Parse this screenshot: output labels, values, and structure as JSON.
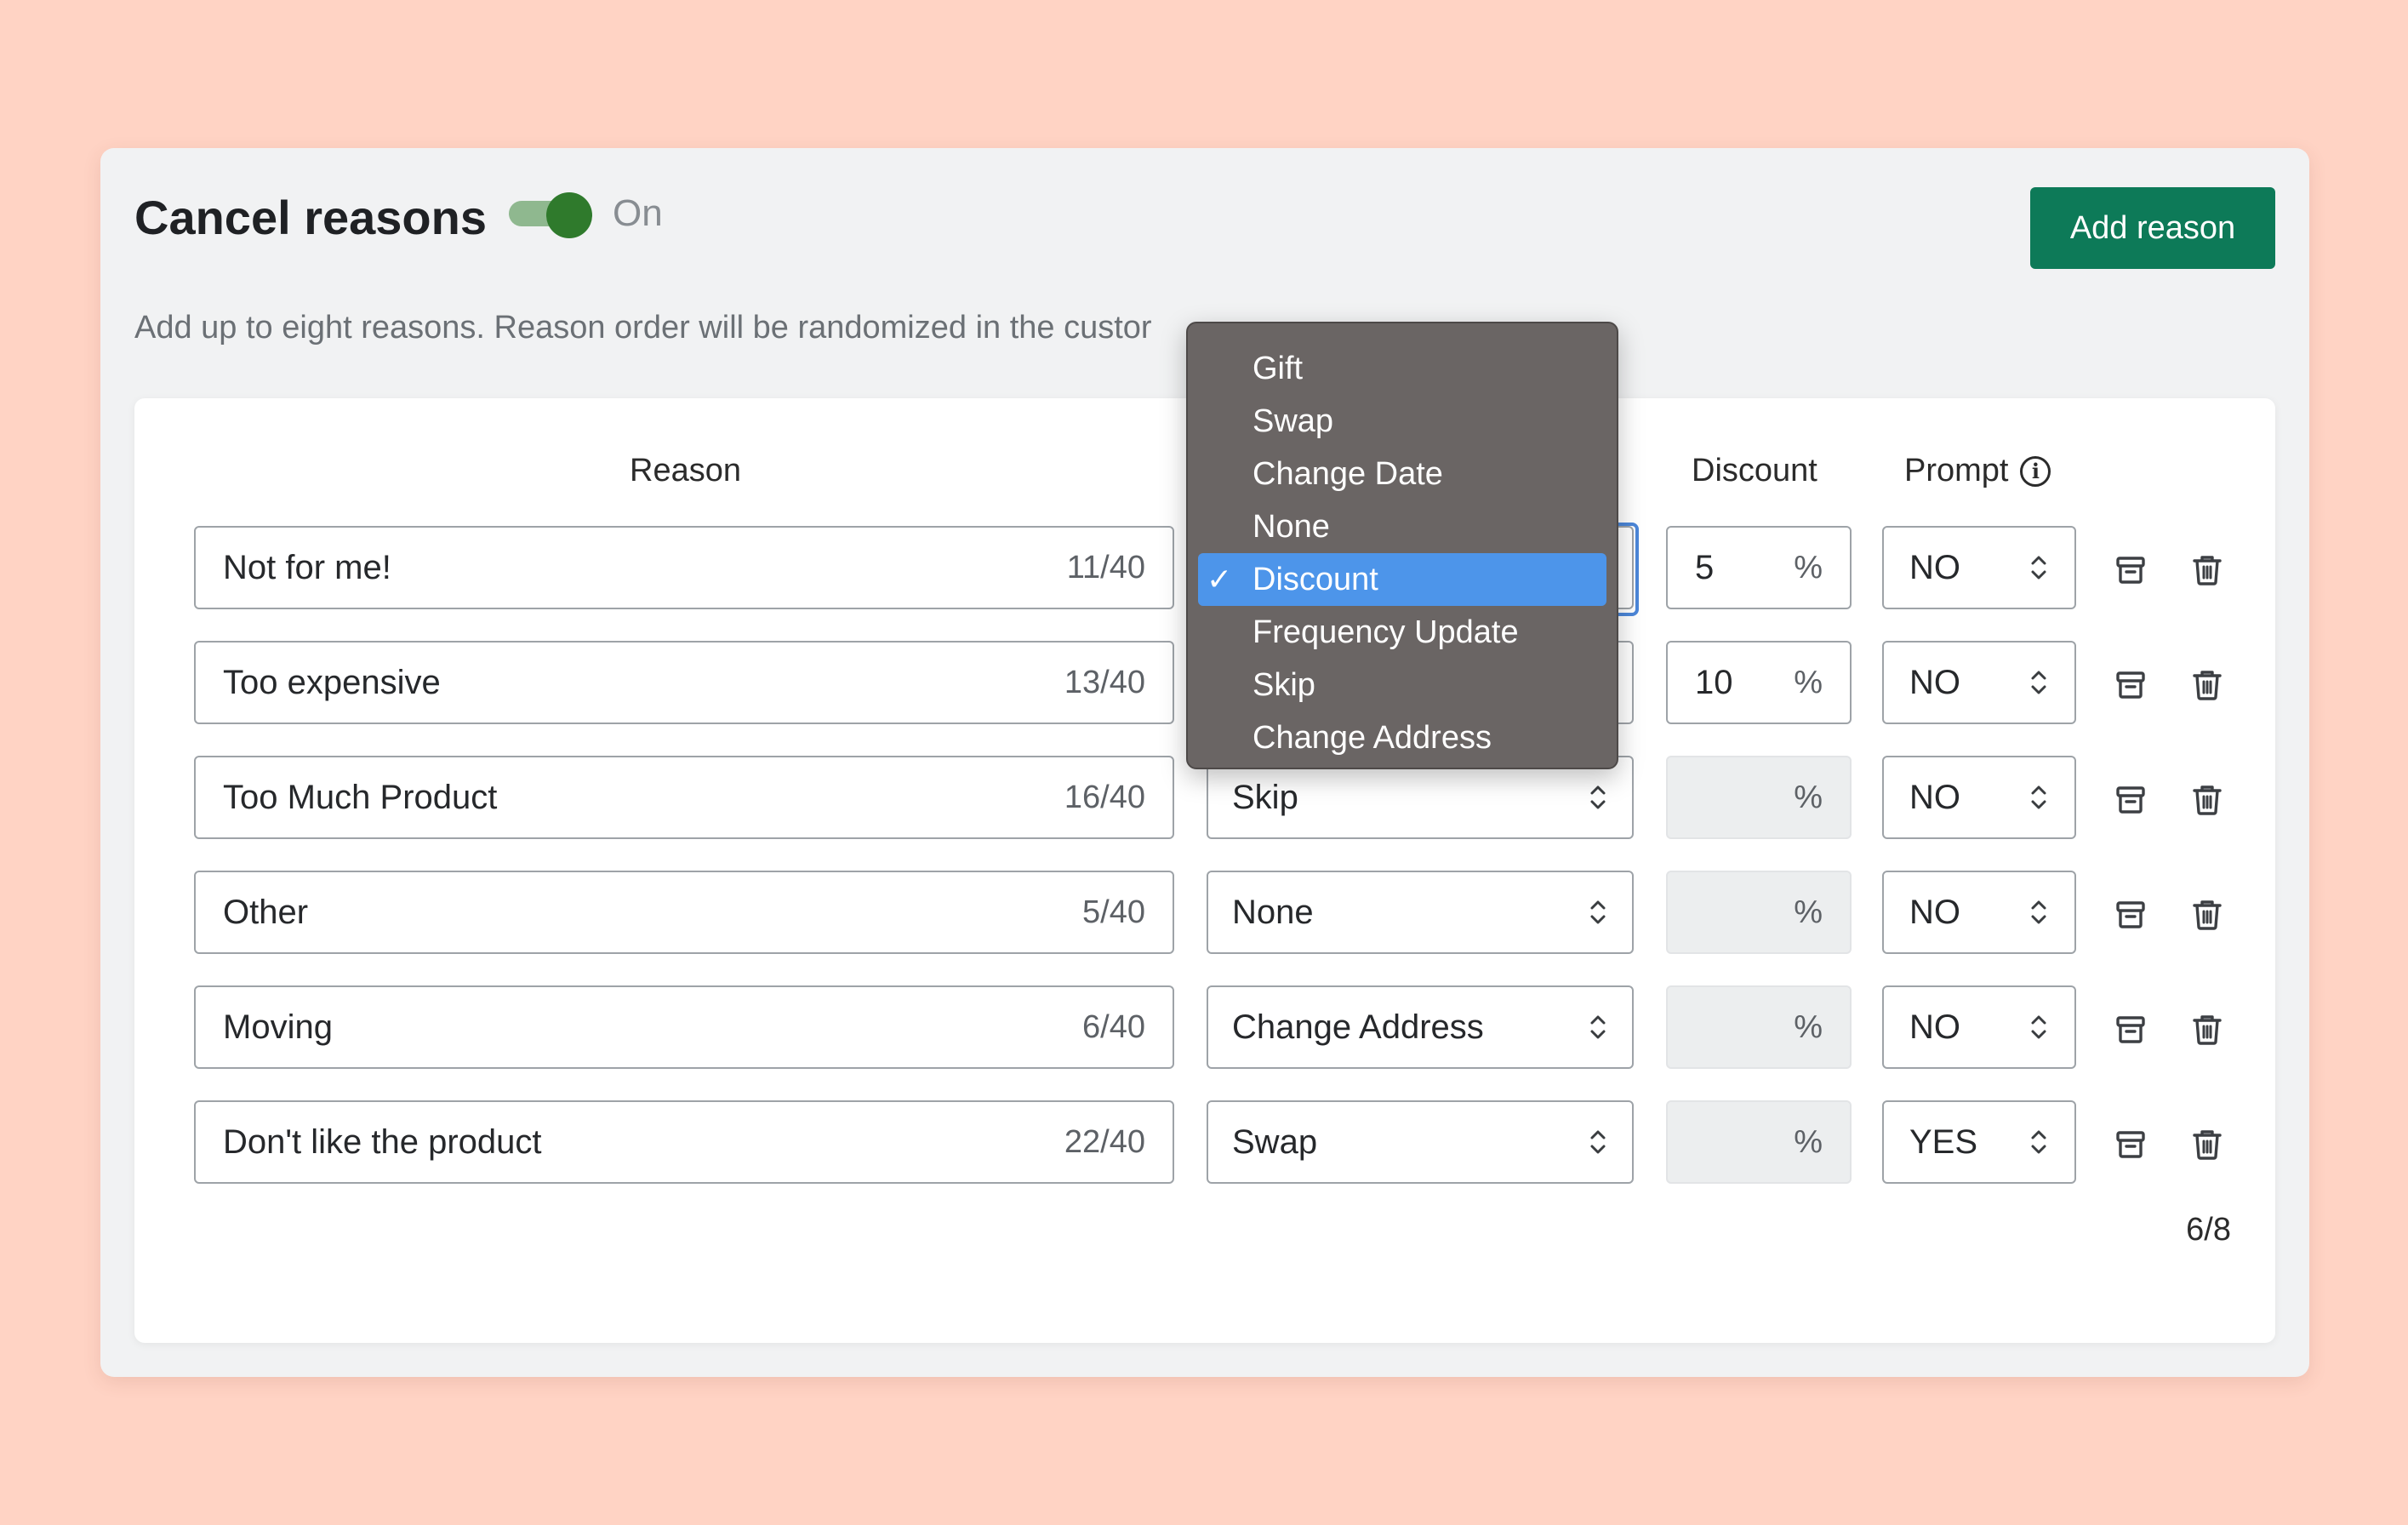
{
  "header": {
    "title": "Cancel reasons",
    "toggle_label": "On",
    "add_button": "Add reason",
    "description": "Add up to eight reasons. Reason order will be randomized in the custor"
  },
  "columns": {
    "reason": "Reason",
    "discount": "Discount",
    "prompt": "Prompt"
  },
  "rows": [
    {
      "reason": "Not for me!",
      "count": "11/40",
      "action": "Discount",
      "discount": "5",
      "pct": "%",
      "prompt": "NO"
    },
    {
      "reason": "Too expensive",
      "count": "13/40",
      "action": "",
      "discount": "10",
      "pct": "%",
      "prompt": "NO"
    },
    {
      "reason": "Too Much Product",
      "count": "16/40",
      "action": "Skip",
      "discount": "",
      "pct": "%",
      "prompt": "NO"
    },
    {
      "reason": "Other",
      "count": "5/40",
      "action": "None",
      "discount": "",
      "pct": "%",
      "prompt": "NO"
    },
    {
      "reason": "Moving",
      "count": "6/40",
      "action": "Change Address",
      "discount": "",
      "pct": "%",
      "prompt": "NO"
    },
    {
      "reason": "Don't like the product",
      "count": "22/40",
      "action": "Swap",
      "discount": "",
      "pct": "%",
      "prompt": "YES"
    }
  ],
  "counter": "6/8",
  "dropdown": {
    "options": [
      "Gift",
      "Swap",
      "Change Date",
      "None",
      "Discount",
      "Frequency Update",
      "Skip",
      "Change Address"
    ],
    "selected": "Discount",
    "check": "✓"
  },
  "colors": {
    "background": "#ffd3c4",
    "brand_green": "#0d7a58",
    "toggle_on": "#2f7a2c",
    "selection_blue": "#4d95ea"
  },
  "icons": [
    "info-icon",
    "stepper-icon",
    "archive-icon",
    "trash-icon",
    "checkmark-icon"
  ]
}
